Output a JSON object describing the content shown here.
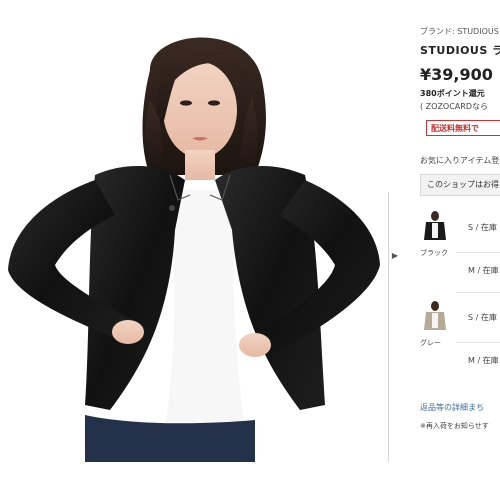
{
  "product": {
    "brand_line": "ブランド: STUDIOUS",
    "name_line": "STUDIOUS ラ",
    "price": "¥39,900",
    "points": "380ポイント還元",
    "zozocard": "( ZOZOCARDなら",
    "shipping_badge": "配送料無料で",
    "favorite": "お気に入りアイテム登",
    "shop_box": "このショップはお得"
  },
  "variants": [
    {
      "color": "ブラック",
      "sizes": [
        "S / 在庫",
        "M / 在庫"
      ]
    },
    {
      "color": "グレー",
      "sizes": [
        "S / 在庫",
        "M / 在庫"
      ]
    }
  ],
  "footer_links": {
    "returns": "返品等の詳細まち",
    "note": "※再入荷をお知らせす"
  },
  "ui": {
    "arrow": "▶"
  }
}
